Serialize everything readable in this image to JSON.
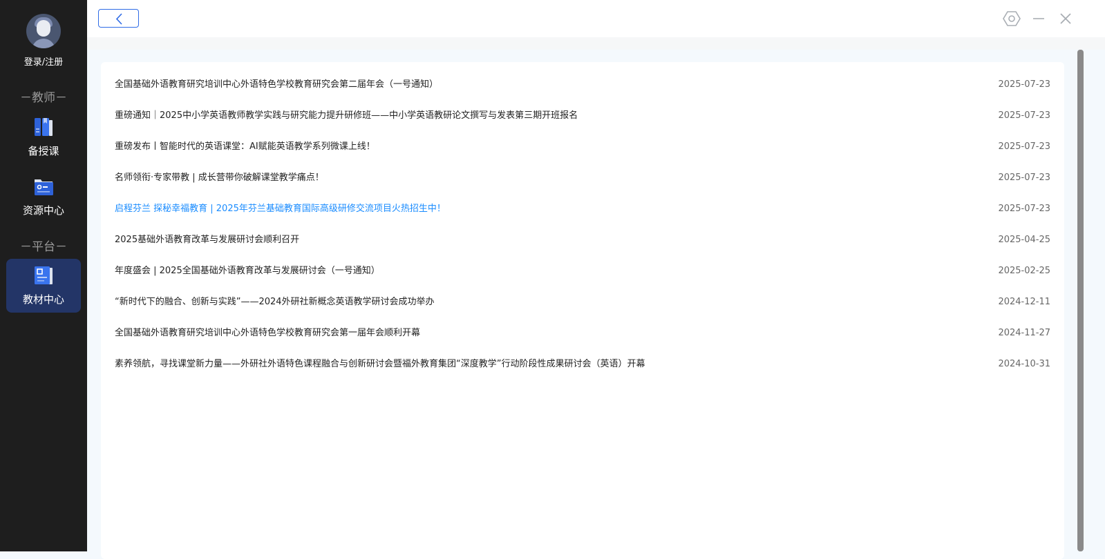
{
  "sidebar": {
    "login": "登录/注册",
    "section_teacher": "－教师－",
    "section_platform": "－平台－",
    "items": [
      {
        "label": "备授课"
      },
      {
        "label": "资源中心"
      },
      {
        "label": "教材中心"
      }
    ]
  },
  "colors": {
    "sidebar_bg": "#1e1e1e",
    "active_bg": "#233567",
    "accent": "#2e6be6",
    "link_highlight": "#1a8cff"
  },
  "news": [
    {
      "title": "全国基础外语教育研究培训中心外语特色学校教育研究会第二届年会（一号通知）",
      "date": "2025-07-23"
    },
    {
      "title": "重磅通知｜2025中小学英语教师教学实践与研究能力提升研修班——中小学英语教研论文撰写与发表第三期开班报名",
      "date": "2025-07-23"
    },
    {
      "title": "重磅发布丨智能时代的英语课堂：AI赋能英语教学系列微课上线！",
      "date": "2025-07-23"
    },
    {
      "title": "名师领衔·专家带教 | 成长营带你破解课堂教学痛点！",
      "date": "2025-07-23"
    },
    {
      "title": "启程芬兰 探秘幸福教育 | 2025年芬兰基础教育国际高级研修交流项目火热招生中！",
      "date": "2025-07-23"
    },
    {
      "title": "2025基础外语教育改革与发展研讨会顺利召开",
      "date": "2025-04-25"
    },
    {
      "title": "年度盛会 | 2025全国基础外语教育改革与发展研讨会（一号通知）",
      "date": "2025-02-25"
    },
    {
      "title": "“新时代下的融合、创新与实践”——2024外研社新概念英语教学研讨会成功举办",
      "date": "2024-12-11"
    },
    {
      "title": "全国基础外语教育研究培训中心外语特色学校教育研究会第一届年会顺利开幕",
      "date": "2024-11-27"
    },
    {
      "title": "素养领航，寻找课堂新力量——外研社外语特色课程融合与创新研讨会暨福外教育集团“深度教学”行动阶段性成果研讨会（英语）开幕",
      "date": "2024-10-31"
    }
  ]
}
